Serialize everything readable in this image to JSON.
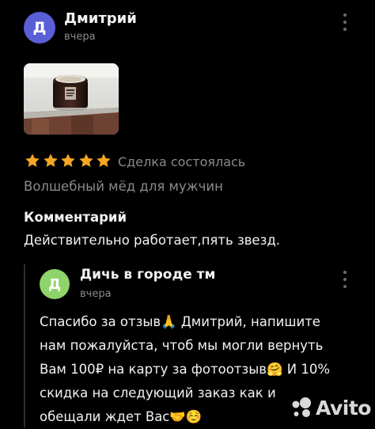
{
  "review": {
    "avatar_letter": "Д",
    "author": "Дмитрий",
    "date": "вчера",
    "rating": 5,
    "rating_max": 5,
    "deal_status": "Сделка состоялась",
    "product": "Волшебный мёд для мужчин",
    "comment_title": "Комментарий",
    "comment_text": "Действительно работает,пять звезд."
  },
  "reply": {
    "avatar_letter": "Д",
    "author": "Дичь в городе тм",
    "date": "вчера",
    "lines": [
      "Спасибо за отзыв🙏 Дмитрий, напишите",
      "нам пожалуйста, чтоб мы могли вернуть",
      "Вам 100₽ на карту за фотоотзыв🤗 И 10%",
      "скидка на следующий заказ как и",
      "обещали ждет Вас🤝☺️"
    ]
  },
  "colors": {
    "background": "#000000",
    "star": "#f5a623",
    "avatar_main": "#5a5fd6",
    "avatar_reply": "#8fd36b",
    "muted_text": "#8a8a8a"
  },
  "icons": {
    "menu": "more-vertical-icon",
    "star": "star-icon",
    "watermark": "avito-logo"
  },
  "watermark": {
    "text": "Avito"
  }
}
